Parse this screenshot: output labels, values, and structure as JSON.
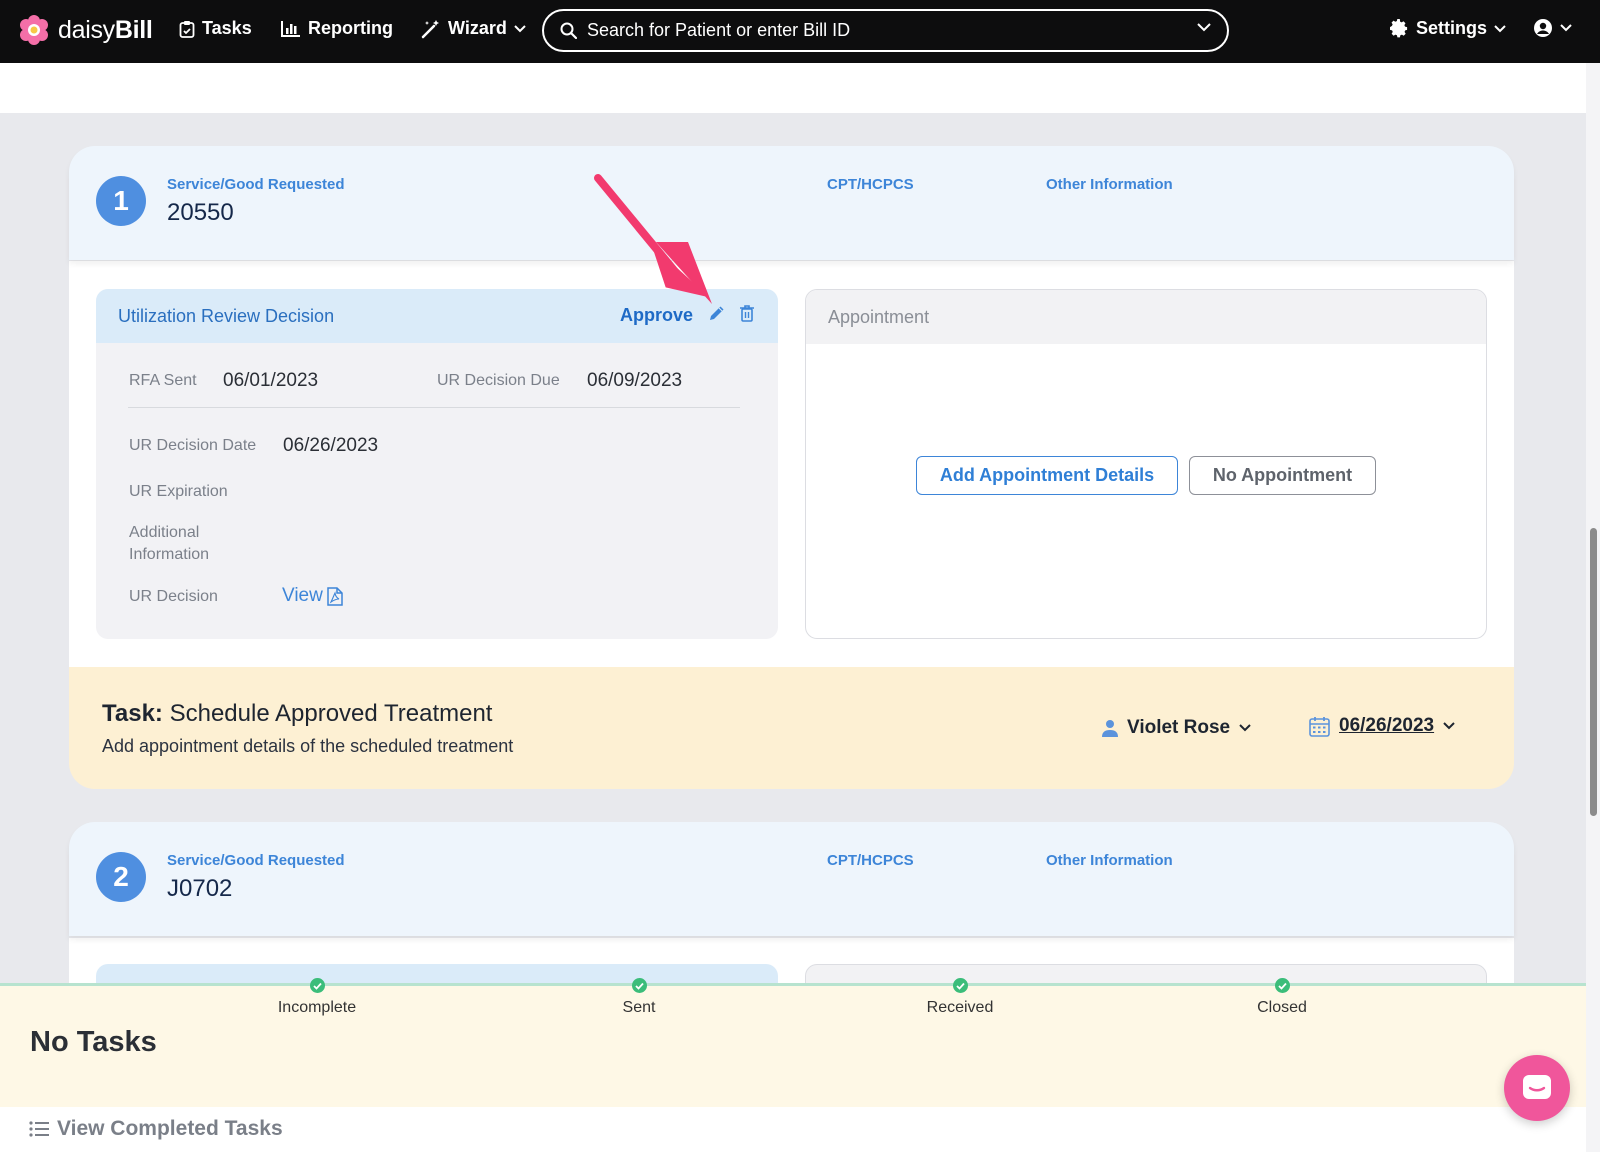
{
  "nav": {
    "brand_light": "daisy",
    "brand_bold": "Bill",
    "tasks": "Tasks",
    "reporting": "Reporting",
    "wizard": "Wizard",
    "search_placeholder": "Search for Patient or enter Bill ID",
    "settings": "Settings"
  },
  "services": [
    {
      "number": "1",
      "service_label": "Service/Good Requested",
      "service_value": "20550",
      "cpt_label": "CPT/HCPCS",
      "other_label": "Other Information"
    },
    {
      "number": "2",
      "service_label": "Service/Good Requested",
      "service_value": "J0702",
      "cpt_label": "CPT/HCPCS",
      "other_label": "Other Information"
    }
  ],
  "ur_decision": {
    "title": "Utilization Review Decision",
    "status": "Approve",
    "rfa_sent_label": "RFA Sent",
    "rfa_sent": "06/01/2023",
    "due_label": "UR Decision Due",
    "due": "06/09/2023",
    "date_label": "UR Decision Date",
    "date": "06/26/2023",
    "expiration_label": "UR Expiration",
    "additional_label_1": "Additional",
    "additional_label_2": "Information",
    "decision_label": "UR Decision",
    "view_link": "View"
  },
  "appointment": {
    "title": "Appointment",
    "add_button": "Add Appointment Details",
    "none_button": "No Appointment"
  },
  "task": {
    "prefix": "Task:",
    "title": "Schedule Approved Treatment",
    "description": "Add appointment details of the scheduled treatment",
    "assignee": "Violet Rose",
    "due_date": "06/26/2023"
  },
  "progress": {
    "steps": [
      "Incomplete",
      "Sent",
      "Received",
      "Closed"
    ],
    "status_color": "#3bbd7a"
  },
  "bottom": {
    "no_tasks": "No Tasks",
    "view_completed": "View Completed Tasks"
  },
  "colors": {
    "accent": "#3d85d8",
    "annotation_arrow": "#f23a6e",
    "task_bg": "#fdf0d3",
    "chat": "#f0569b"
  }
}
